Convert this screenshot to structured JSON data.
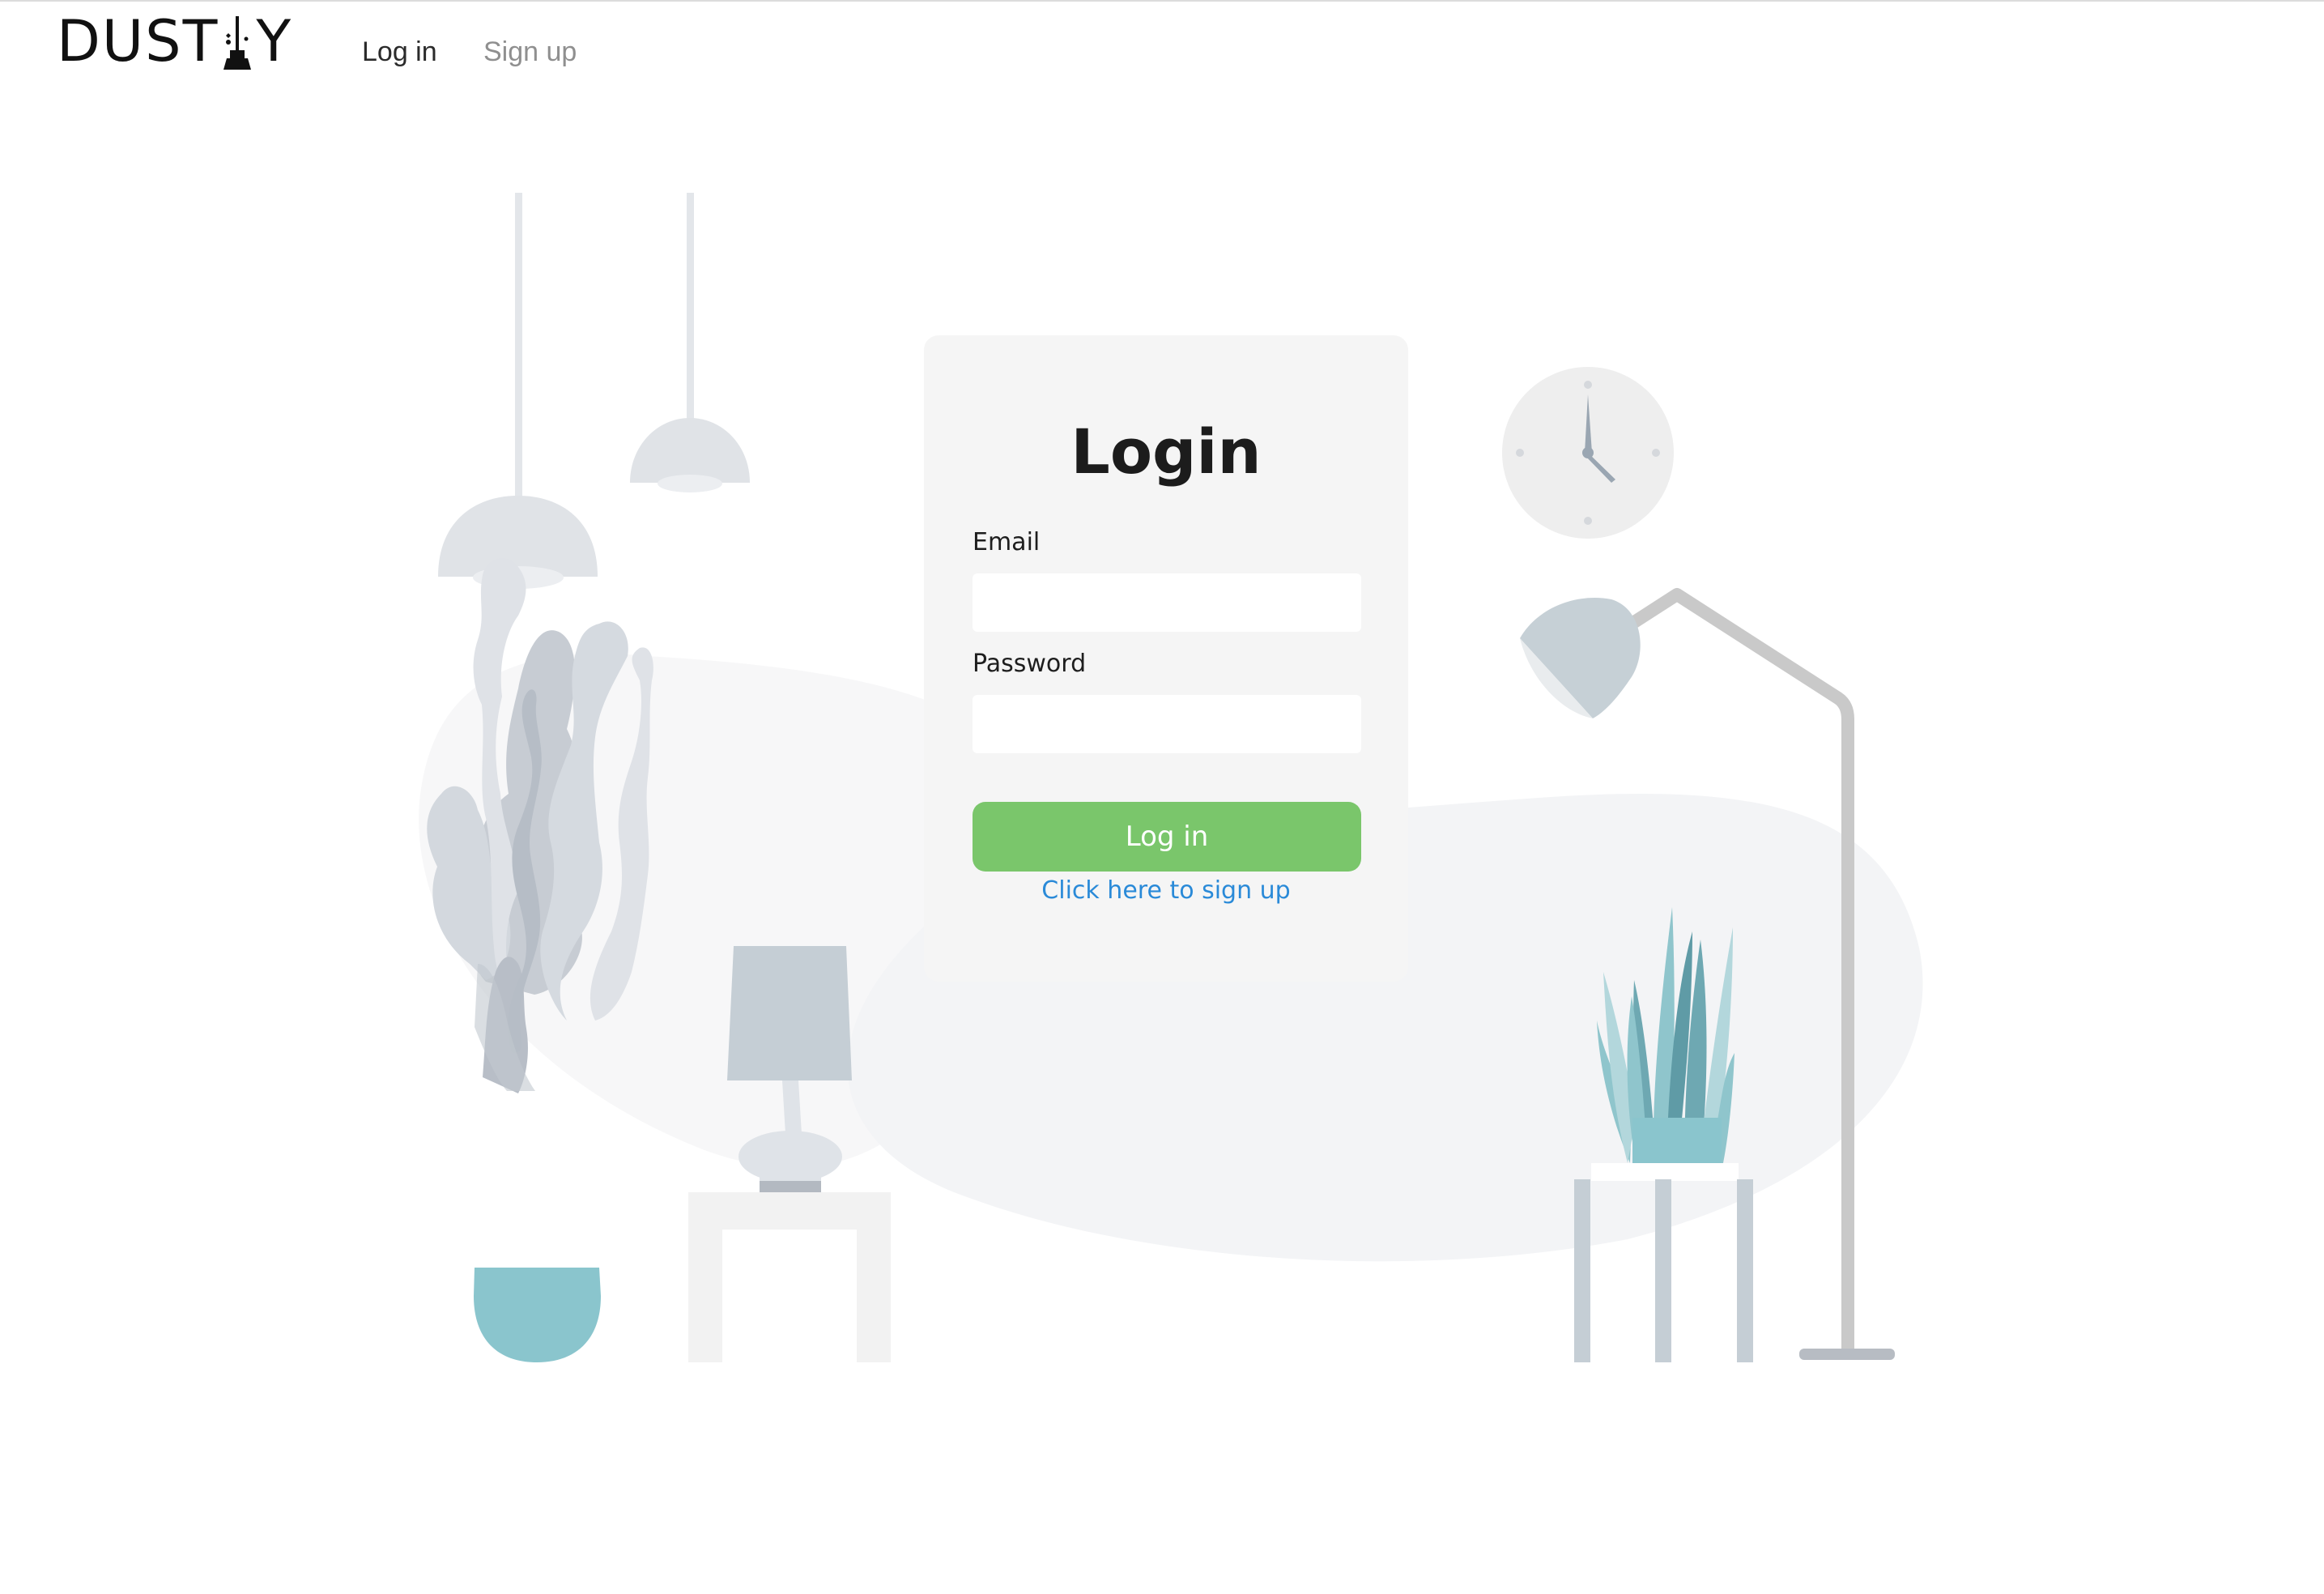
{
  "nav": {
    "logo_text_left": "DUST",
    "logo_text_right": "Y",
    "login_label": "Log in",
    "signup_label": "Sign up"
  },
  "login": {
    "title": "Login",
    "email_label": "Email",
    "email_value": "",
    "password_label": "Password",
    "password_value": "",
    "submit_label": "Log in",
    "signup_link_label": "Click here to sign up"
  },
  "colors": {
    "primary_button": "#7ac66b",
    "link": "#2a8ad8",
    "card_background": "#f4f4f4"
  },
  "icons": {
    "logo_glyph": "broom-icon"
  }
}
